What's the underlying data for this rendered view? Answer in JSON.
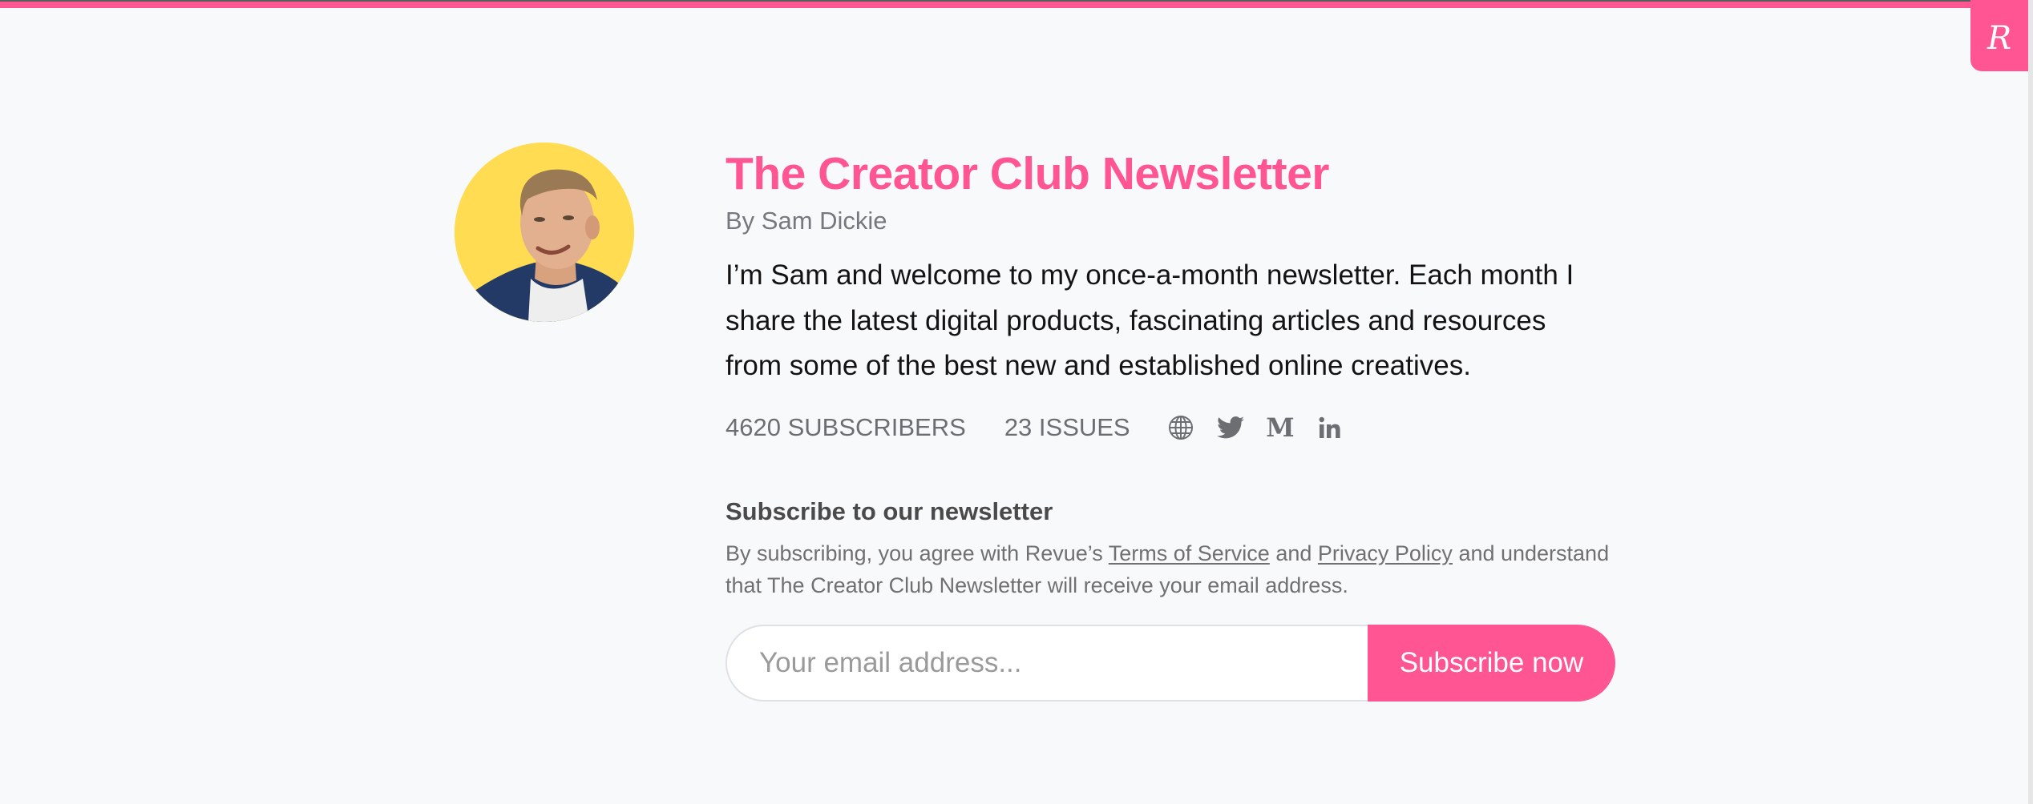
{
  "brand": {
    "badge_letter": "R",
    "accent_color": "#FF5592"
  },
  "profile": {
    "avatar_alt": "Sam Dickie portrait"
  },
  "newsletter": {
    "title": "The Creator Club Newsletter",
    "byline": "By Sam Dickie",
    "description": "I’m Sam and welcome to my once-a-month newsletter. Each month I share the latest digital products, fascinating articles and resources from some of the best new and established online creatives."
  },
  "stats": {
    "subscribers": "4620 SUBSCRIBERS",
    "issues": "23 ISSUES"
  },
  "social": [
    {
      "name": "website",
      "icon": "globe-icon"
    },
    {
      "name": "twitter",
      "icon": "twitter-icon"
    },
    {
      "name": "medium",
      "icon": "medium-icon"
    },
    {
      "name": "linkedin",
      "icon": "linkedin-icon"
    }
  ],
  "subscribe": {
    "heading": "Subscribe to our newsletter",
    "terms_prefix": "By subscribing, you agree with Revue’s ",
    "terms_link": "Terms of Service",
    "terms_and": " and ",
    "privacy_link": "Privacy Policy",
    "terms_suffix": " and understand that The Creator Club Newsletter will receive your email address.",
    "email_placeholder": "Your email address...",
    "email_value": "",
    "button_label": "Subscribe now"
  }
}
